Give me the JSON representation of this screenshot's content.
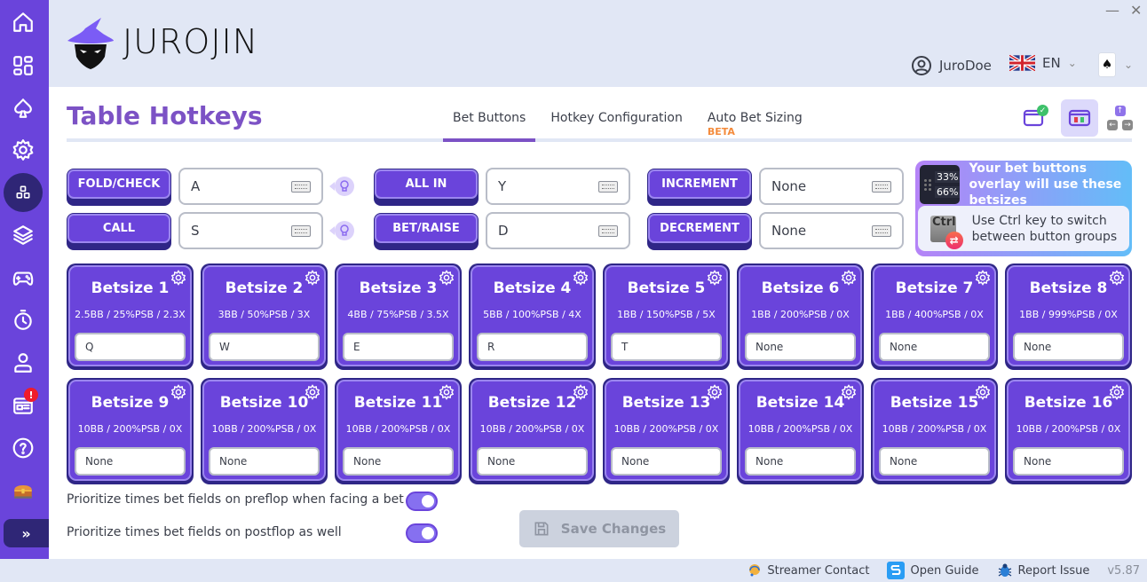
{
  "app": {
    "logo_text": "JUROJIN",
    "window_controls": {
      "minimize": "—",
      "close": "✕"
    },
    "user": {
      "name": "JuroDoe"
    },
    "language": {
      "code": "EN"
    }
  },
  "sidebar": {
    "items": [
      {
        "name": "home",
        "label": "Home"
      },
      {
        "name": "dashboard",
        "label": "Dashboard"
      },
      {
        "name": "poker",
        "label": "Poker"
      },
      {
        "name": "settings",
        "label": "Settings"
      },
      {
        "name": "table-hotkeys",
        "label": "Table Hotkeys",
        "active": true
      },
      {
        "name": "layers",
        "label": "Layers"
      },
      {
        "name": "gamepad",
        "label": "Games"
      },
      {
        "name": "timer",
        "label": "Timer"
      },
      {
        "name": "profile",
        "label": "Profile"
      },
      {
        "name": "news",
        "label": "News",
        "badge": "!"
      },
      {
        "name": "help",
        "label": "Help"
      },
      {
        "name": "treasure",
        "label": "Rewards"
      }
    ],
    "expand_label": "»"
  },
  "page": {
    "title": "Table Hotkeys",
    "tabs": [
      {
        "label": "Bet Buttons",
        "active": true
      },
      {
        "label": "Hotkey Configuration",
        "active": false
      },
      {
        "label": "Auto Bet Sizing",
        "badge": "BETA",
        "active": false
      }
    ]
  },
  "actions": [
    {
      "label": "FOLD/CHECK",
      "key": "A"
    },
    {
      "label": "CALL",
      "key": "S"
    },
    {
      "label": "ALL IN",
      "key": "Y"
    },
    {
      "label": "BET/RAISE",
      "key": "D"
    },
    {
      "label": "INCREMENT",
      "key": "None"
    },
    {
      "label": "DECREMENT",
      "key": "None"
    }
  ],
  "info": {
    "pct_top": "33%",
    "pct_bottom": "66%",
    "overlay_text": "Your bet buttons overlay will use these betsizes",
    "ctrl_key": "Ctrl",
    "ctrl_text": "Use Ctrl key to switch between button groups"
  },
  "betsizes": [
    {
      "title": "Betsize 1",
      "sub": "2.5BB / 25%PSB / 2.3X",
      "key": "Q"
    },
    {
      "title": "Betsize 2",
      "sub": "3BB / 50%PSB / 3X",
      "key": "W"
    },
    {
      "title": "Betsize 3",
      "sub": "4BB / 75%PSB / 3.5X",
      "key": "E"
    },
    {
      "title": "Betsize 4",
      "sub": "5BB / 100%PSB / 4X",
      "key": "R"
    },
    {
      "title": "Betsize 5",
      "sub": "1BB / 150%PSB / 5X",
      "key": "T"
    },
    {
      "title": "Betsize 6",
      "sub": "1BB / 200%PSB / 0X",
      "key": "None"
    },
    {
      "title": "Betsize 7",
      "sub": "1BB / 400%PSB / 0X",
      "key": "None"
    },
    {
      "title": "Betsize 8",
      "sub": "1BB / 999%PSB / 0X",
      "key": "None"
    },
    {
      "title": "Betsize 9",
      "sub": "10BB / 200%PSB / 0X",
      "key": "None"
    },
    {
      "title": "Betsize 10",
      "sub": "10BB / 200%PSB / 0X",
      "key": "None"
    },
    {
      "title": "Betsize 11",
      "sub": "10BB / 200%PSB / 0X",
      "key": "None"
    },
    {
      "title": "Betsize 12",
      "sub": "10BB / 200%PSB / 0X",
      "key": "None"
    },
    {
      "title": "Betsize 13",
      "sub": "10BB / 200%PSB / 0X",
      "key": "None"
    },
    {
      "title": "Betsize 14",
      "sub": "10BB / 200%PSB / 0X",
      "key": "None"
    },
    {
      "title": "Betsize 15",
      "sub": "10BB / 200%PSB / 0X",
      "key": "None"
    },
    {
      "title": "Betsize 16",
      "sub": "10BB / 200%PSB / 0X",
      "key": "None"
    }
  ],
  "toggles": [
    {
      "label": "Prioritize times bet fields on preflop when facing a bet",
      "on": true
    },
    {
      "label": "Prioritize times bet fields on postflop as well",
      "on": true
    }
  ],
  "save_label": "Save Changes",
  "footer": {
    "streamer": "Streamer Contact",
    "guide": "Open Guide",
    "report": "Report Issue",
    "version": "v5.87"
  },
  "colors": {
    "accent": "#6a44db",
    "accent_dark": "#2f2687",
    "title": "#7c52c5",
    "beta": "#f48b3c"
  }
}
